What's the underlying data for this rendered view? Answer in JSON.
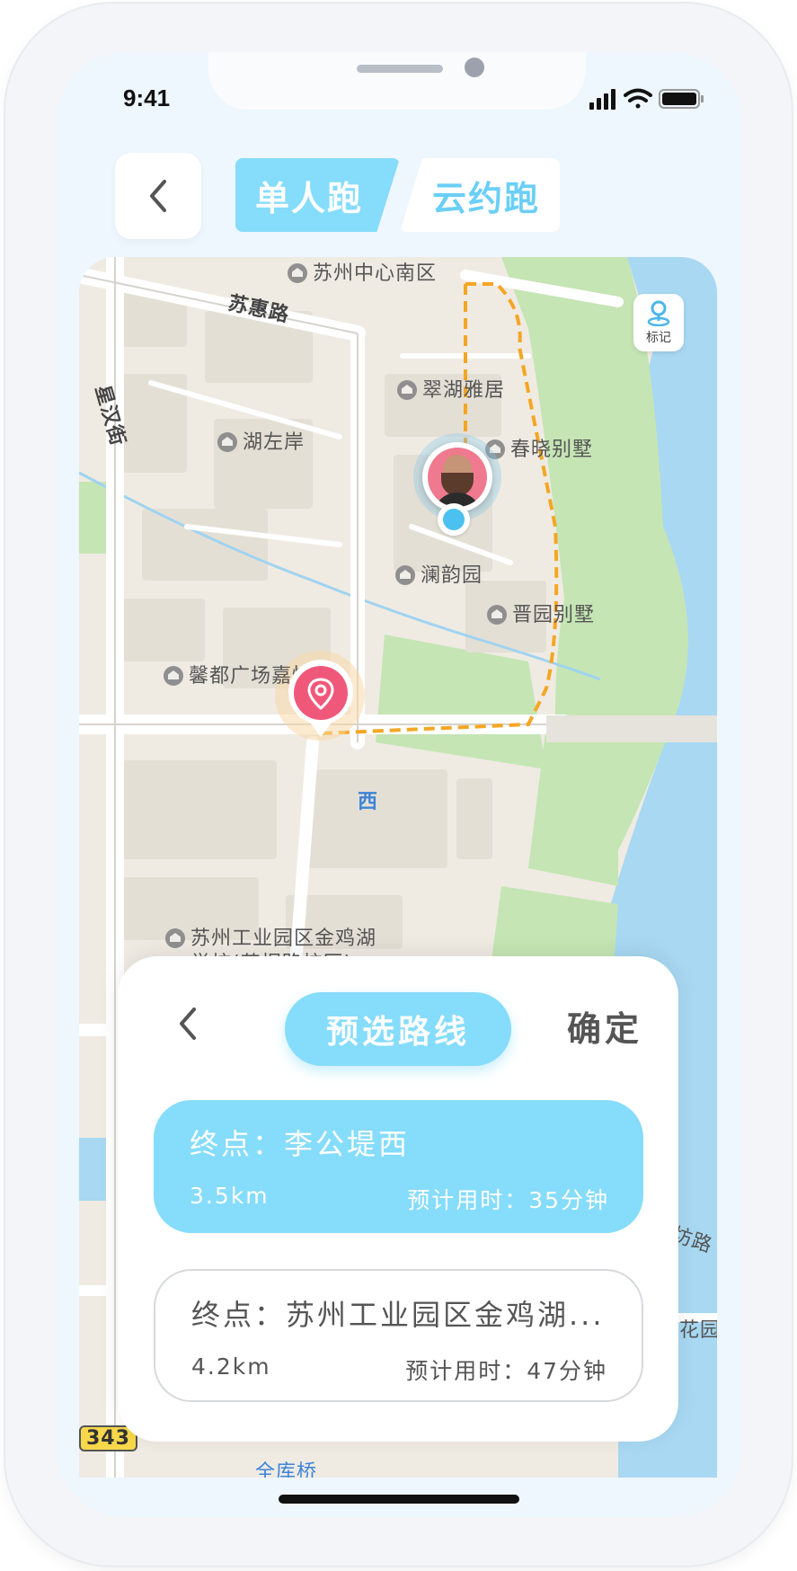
{
  "status_bar": {
    "time": "9:41"
  },
  "header": {
    "tabs": [
      {
        "label": "单人跑",
        "active": true
      },
      {
        "label": "云约跑",
        "active": false
      }
    ]
  },
  "map": {
    "labels": {
      "center_south": "苏州中心南区",
      "suhui_road": "苏惠路",
      "xinghan_street": "星汉街",
      "cuihu": "翠湖雅居",
      "huzuoan": "湖左岸",
      "chunxiao": "春晓别墅",
      "lanyun": "澜韵园",
      "jinyuan": "晋园别墅",
      "xindu": "馨都广场嘉怡苑",
      "ligong_partial": "西",
      "school_line1": "苏州工业园区金鸡湖",
      "school_line2": "学校(苏桐路校区)",
      "fang_road": "坊路",
      "garden": "花园",
      "quanku_bridge": "全库桥",
      "road_badge": "343"
    },
    "mark_button_label": "标记",
    "colors": {
      "route": "#f5a623",
      "water": "#a8d8f2",
      "park": "#c5e5b4",
      "accent": "#86dcfb",
      "start_pin": "#f0587a"
    }
  },
  "route_sheet": {
    "title": "预选路线",
    "confirm_label": "确定",
    "routes": [
      {
        "destination": "终点：李公堤西",
        "distance": "3.5km",
        "estimate": "预计用时：35分钟",
        "selected": true
      },
      {
        "destination": "终点：苏州工业园区金鸡湖...",
        "distance": "4.2km",
        "estimate": "预计用时：47分钟",
        "selected": false
      }
    ]
  }
}
